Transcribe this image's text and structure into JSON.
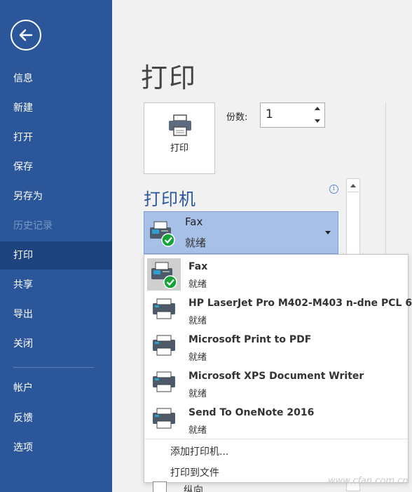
{
  "sidebar": {
    "back_icon": "back-arrow-icon",
    "items": [
      {
        "label": "信息",
        "state": "normal"
      },
      {
        "label": "新建",
        "state": "normal"
      },
      {
        "label": "打开",
        "state": "normal"
      },
      {
        "label": "保存",
        "state": "normal"
      },
      {
        "label": "另存为",
        "state": "normal"
      },
      {
        "label": "历史记录",
        "state": "disabled"
      },
      {
        "label": "打印",
        "state": "active"
      },
      {
        "label": "共享",
        "state": "normal"
      },
      {
        "label": "导出",
        "state": "normal"
      },
      {
        "label": "关闭",
        "state": "normal"
      },
      {
        "label": "帐户",
        "state": "normal"
      },
      {
        "label": "反馈",
        "state": "normal"
      },
      {
        "label": "选项",
        "state": "normal"
      }
    ]
  },
  "main": {
    "title": "打印",
    "print_button_label": "打印",
    "copies_label": "份数:",
    "copies_value": "1",
    "printer_section_title": "打印机",
    "info_icon": "i",
    "selected_printer": {
      "name": "Fax",
      "status": "就绪"
    },
    "printer_list": [
      {
        "name": "Fax",
        "status": "就绪",
        "icon": "fax-icon",
        "selected": true
      },
      {
        "name": "HP LaserJet Pro M402-M403 n-dne PCL 6",
        "status": "就绪",
        "icon": "printer-icon",
        "selected": false
      },
      {
        "name": "Microsoft Print to PDF",
        "status": "就绪",
        "icon": "printer-icon",
        "selected": false
      },
      {
        "name": "Microsoft XPS Document Writer",
        "status": "就绪",
        "icon": "printer-icon",
        "selected": false
      },
      {
        "name": "Send To OneNote 2016",
        "status": "就绪",
        "icon": "printer-icon",
        "selected": false
      }
    ],
    "add_printer_label": "添加打印机...",
    "print_to_file_label": "打印到文件",
    "orientation_label": "纵向"
  },
  "watermark": "www.cfan.com.cn",
  "colors": {
    "sidebar": "#2b579a",
    "sidebar_active": "#1e4480",
    "accent": "#2b579a",
    "selected_printer_bg": "#a6c0e8",
    "ready_check": "#16a33a"
  }
}
